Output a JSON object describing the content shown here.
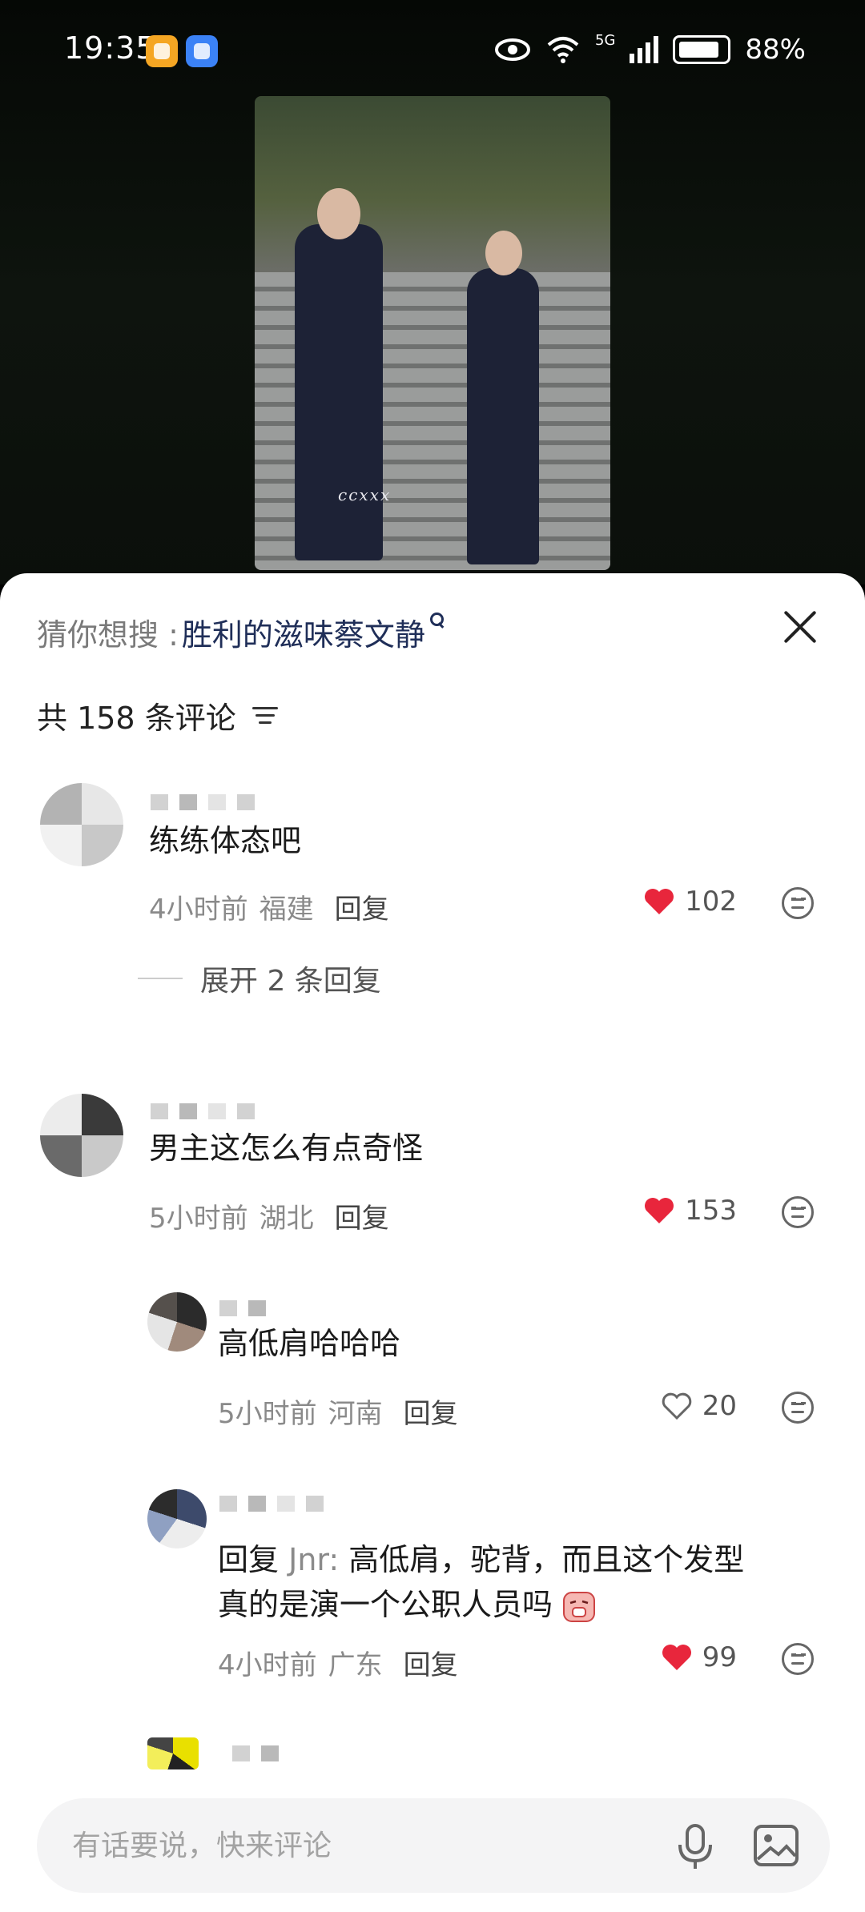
{
  "status_bar": {
    "time": "19:35",
    "network": "5G",
    "battery": "88%"
  },
  "video": {
    "watermark": "ccxxx"
  },
  "search_suggestion": {
    "label": "猜你想搜 :",
    "term": "胜利的滋味蔡文静"
  },
  "comments_header": {
    "count_label": "共 158 条评论"
  },
  "comments": [
    {
      "text": "练练体态吧",
      "time": "4小时前",
      "location": "福建",
      "reply_label": "回复",
      "likes": "102",
      "liked": true,
      "expand_label": "展开 2 条回复"
    },
    {
      "text": "男主这怎么有点奇怪",
      "time": "5小时前",
      "location": "湖北",
      "reply_label": "回复",
      "likes": "153",
      "liked": true,
      "replies": [
        {
          "text": "高低肩哈哈哈",
          "time": "5小时前",
          "location": "河南",
          "reply_label": "回复",
          "likes": "20",
          "liked": false
        },
        {
          "reply_prefix": "回复",
          "reply_to": "Jnr:",
          "text_line1": "高低肩，驼背，而且这个发型",
          "text_line2": "真的是演一个公职人员吗",
          "time": "4小时前",
          "location": "广东",
          "reply_label": "回复",
          "likes": "99",
          "liked": true
        }
      ]
    }
  ],
  "input": {
    "placeholder": "有话要说，快来评论"
  },
  "colors": {
    "like_red": "#e8263c",
    "link_blue": "#1f2e58"
  }
}
